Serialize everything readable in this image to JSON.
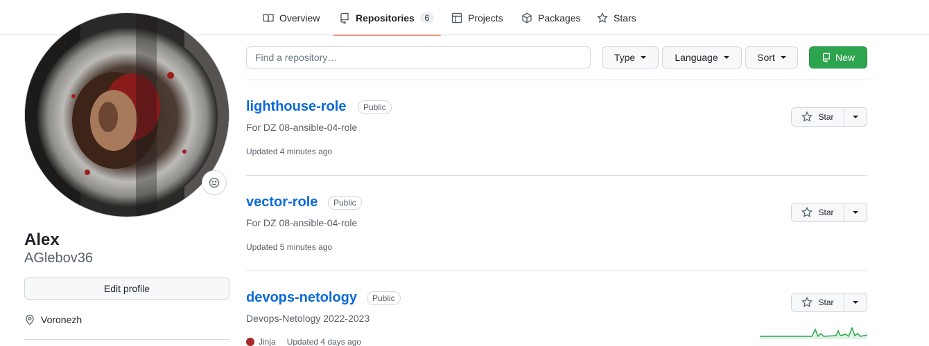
{
  "nav": {
    "tabs": [
      {
        "label": "Overview",
        "icon": "book-open-icon"
      },
      {
        "label": "Repositories",
        "icon": "repo-icon",
        "count": "6",
        "active": true
      },
      {
        "label": "Projects",
        "icon": "table-icon"
      },
      {
        "label": "Packages",
        "icon": "package-icon"
      },
      {
        "label": "Stars",
        "icon": "star-icon"
      }
    ]
  },
  "profile": {
    "name": "Alex",
    "login": "AGlebov36",
    "edit_label": "Edit profile",
    "location": "Voronezh"
  },
  "filters": {
    "search_placeholder": "Find a repository…",
    "type_label": "Type",
    "language_label": "Language",
    "sort_label": "Sort",
    "new_label": "New"
  },
  "repos": [
    {
      "name": "lighthouse-role",
      "visibility": "Public",
      "description": "For DZ 08-ansible-04-role",
      "updated": "Updated 4 minutes ago",
      "star_label": "Star"
    },
    {
      "name": "vector-role",
      "visibility": "Public",
      "description": "For DZ 08-ansible-04-role",
      "updated": "Updated 5 minutes ago",
      "star_label": "Star"
    },
    {
      "name": "devops-netology",
      "visibility": "Public",
      "description": "Devops-Netology 2022-2023",
      "language": "Jinja",
      "updated": "Updated 4 days ago",
      "star_label": "Star"
    }
  ],
  "colors": {
    "link": "#0969da",
    "primary_button": "#2da44e",
    "active_tab_underline": "#fd8c73",
    "language_dot": "#a52a2a",
    "sparkline": "#2da44e"
  }
}
